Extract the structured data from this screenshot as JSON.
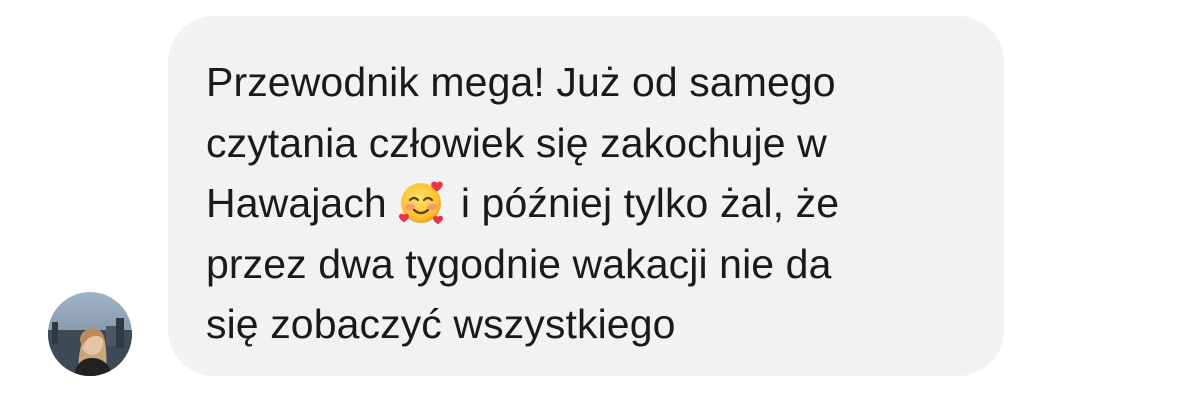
{
  "message": {
    "text_before_emoji": "Przewodnik mega! Już od samego\nczytania człowiek się zakochuje w\nHawajach",
    "emoji": "smiling-face-with-hearts",
    "text_after_emoji": "i później tylko żal, że\nprzez dwa tygodnie wakacji nie da\nsię zobaczyć wszystkiego"
  },
  "colors": {
    "bubble_background": "#f2f2f5",
    "text": "#1a1a1a",
    "page_background": "#ffffff"
  }
}
